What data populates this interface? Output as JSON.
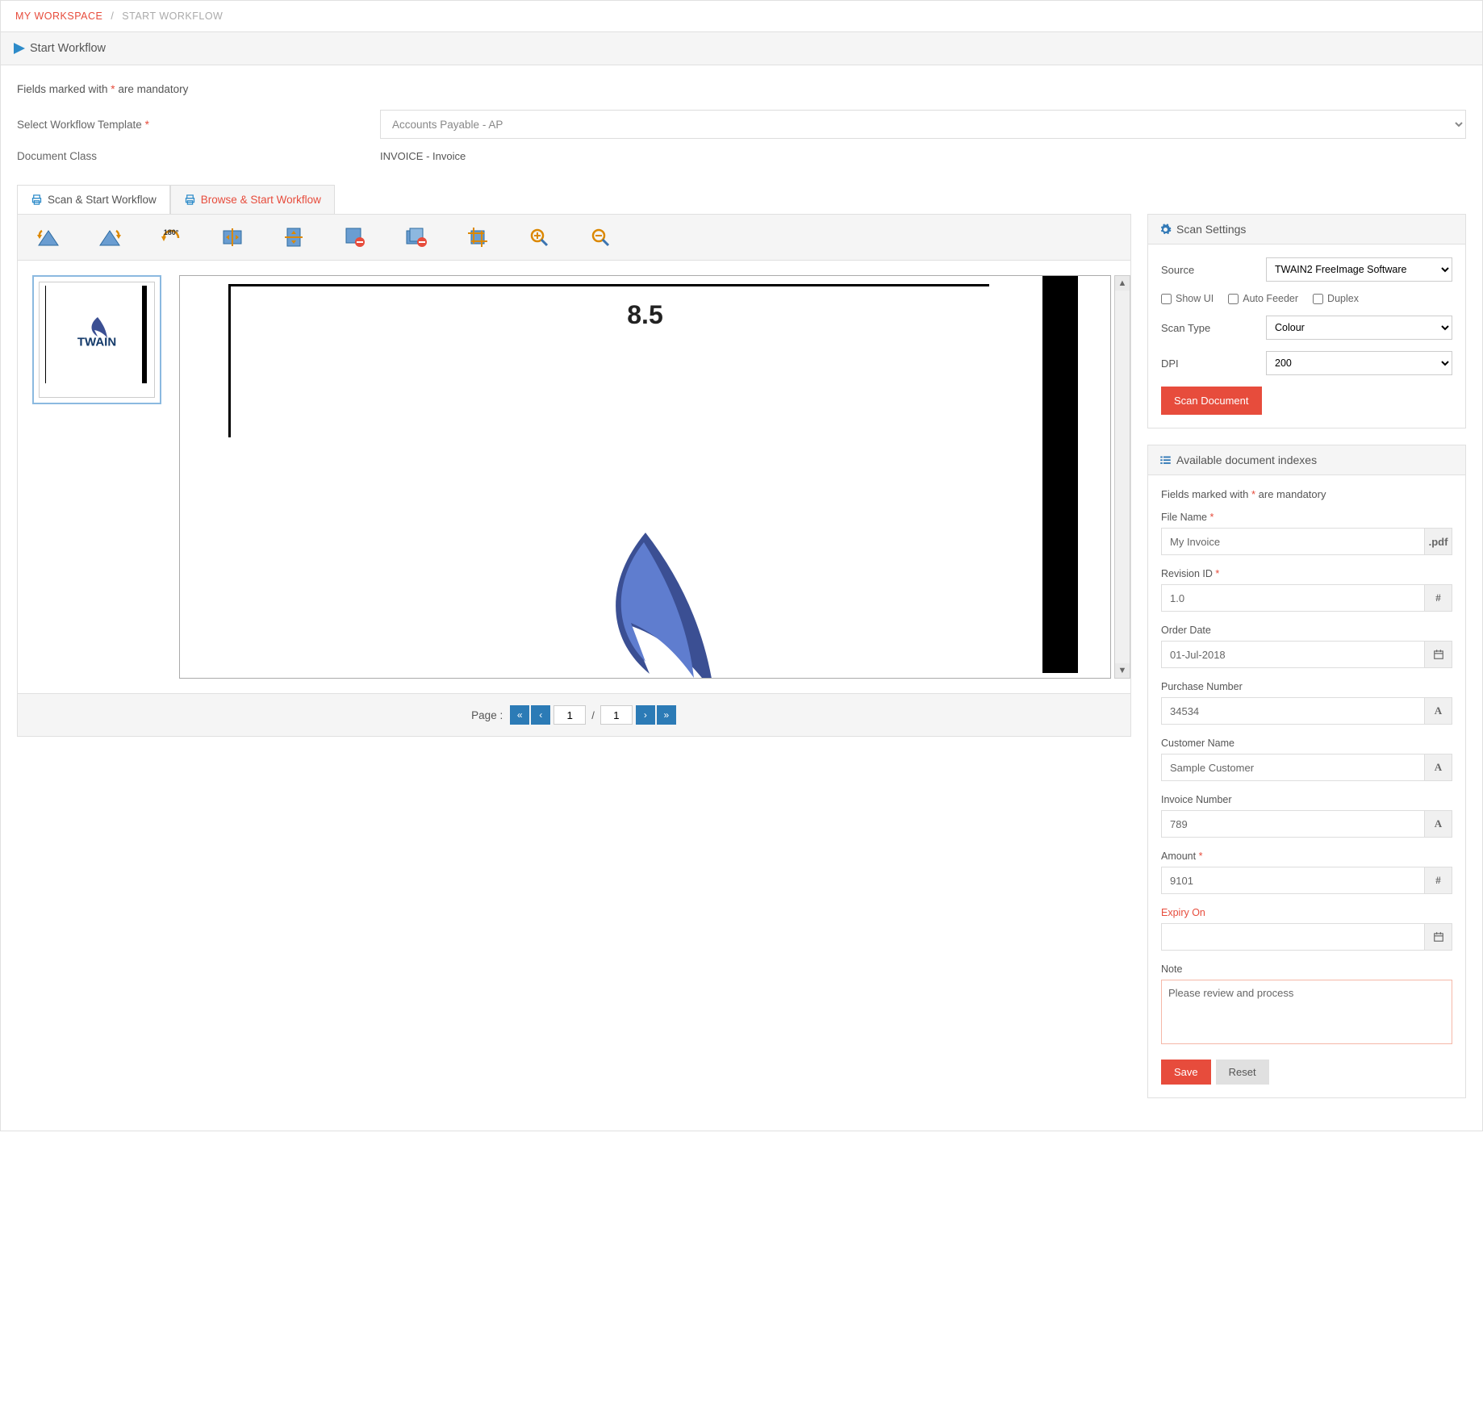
{
  "breadcrumb": {
    "home": "MY WORKSPACE",
    "current": "START WORKFLOW",
    "sep": "/"
  },
  "header": {
    "title": "Start Workflow"
  },
  "form": {
    "mandatory_prefix": "Fields marked with ",
    "mandatory_ast": "*",
    "mandatory_suffix": " are mandatory",
    "template_label": "Select Workflow Template ",
    "template_value": "Accounts Payable - AP",
    "docclass_label": "Document Class",
    "docclass_value": "INVOICE - Invoice"
  },
  "tabs": {
    "scan": "Scan & Start Workflow",
    "browse": "Browse & Start Workflow"
  },
  "viewer": {
    "measure": "8.5",
    "thumb": "TWAIN"
  },
  "pager": {
    "label": "Page : ",
    "current": "1",
    "total": "1",
    "sep": "/"
  },
  "scan_settings": {
    "title": "Scan Settings",
    "source_label": "Source",
    "source_value": "TWAIN2 FreeImage Software",
    "cb_show": "Show UI",
    "cb_feeder": "Auto Feeder",
    "cb_duplex": "Duplex",
    "scantype_label": "Scan Type",
    "scantype_value": "Colour",
    "dpi_label": "DPI",
    "dpi_value": "200",
    "scan_btn": "Scan Document"
  },
  "indexes": {
    "title": "Available document indexes",
    "note_prefix": "Fields marked with ",
    "note_ast": "*",
    "note_suffix": " are mandatory",
    "file_name": {
      "label": "File Name ",
      "value": "My Invoice",
      "suffix": ".pdf"
    },
    "revision": {
      "label": "Revision ID ",
      "value": "1.0",
      "suffix": "#"
    },
    "order_date": {
      "label": "Order Date",
      "value": "01-Jul-2018"
    },
    "purchase": {
      "label": "Purchase Number",
      "value": "34534",
      "suffix": "A"
    },
    "customer": {
      "label": "Customer Name",
      "value": "Sample Customer",
      "suffix": "A"
    },
    "invoice": {
      "label": "Invoice Number",
      "value": "789",
      "suffix": "A"
    },
    "amount": {
      "label": "Amount ",
      "value": "9101",
      "suffix": "#"
    },
    "expiry": {
      "label": "Expiry On",
      "value": ""
    },
    "note": {
      "label": "Note",
      "value": "Please review and process"
    },
    "save": "Save",
    "reset": "Reset"
  }
}
